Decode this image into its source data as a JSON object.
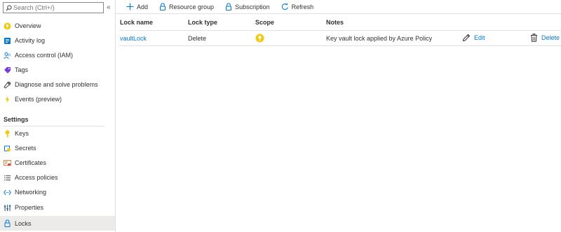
{
  "sidebar": {
    "search_placeholder": "Search (Ctrl+/)",
    "collapse_glyph": "«",
    "items": [
      {
        "label": "Overview",
        "icon": "key-vault-icon"
      },
      {
        "label": "Activity log",
        "icon": "activity-log-icon"
      },
      {
        "label": "Access control (IAM)",
        "icon": "people-icon"
      },
      {
        "label": "Tags",
        "icon": "tag-icon"
      },
      {
        "label": "Diagnose and solve problems",
        "icon": "wrench-icon"
      },
      {
        "label": "Events (preview)",
        "icon": "lightning-icon"
      }
    ],
    "settings_title": "Settings",
    "settings_items": [
      {
        "label": "Keys",
        "icon": "key-icon"
      },
      {
        "label": "Secrets",
        "icon": "secrets-icon"
      },
      {
        "label": "Certificates",
        "icon": "certificate-icon"
      },
      {
        "label": "Access policies",
        "icon": "list-icon"
      },
      {
        "label": "Networking",
        "icon": "networking-icon"
      },
      {
        "label": "Properties",
        "icon": "properties-icon"
      },
      {
        "label": "Locks",
        "icon": "lock-icon",
        "selected": true
      }
    ]
  },
  "toolbar": {
    "add": "Add",
    "resource_group": "Resource group",
    "subscription": "Subscription",
    "refresh": "Refresh"
  },
  "table": {
    "headers": {
      "lock_name": "Lock name",
      "lock_type": "Lock type",
      "scope": "Scope",
      "notes": "Notes"
    },
    "rows": [
      {
        "lock_name": "vaultLock",
        "lock_type": "Delete",
        "scope_icon": "key-vault-icon",
        "notes": "Key vault lock applied by Azure Policy",
        "edit": "Edit",
        "delete": "Delete"
      }
    ]
  },
  "colors": {
    "accent": "#0078d4",
    "selected_bg": "#edebe9",
    "border": "#e1dfdd",
    "text": "#323130"
  }
}
